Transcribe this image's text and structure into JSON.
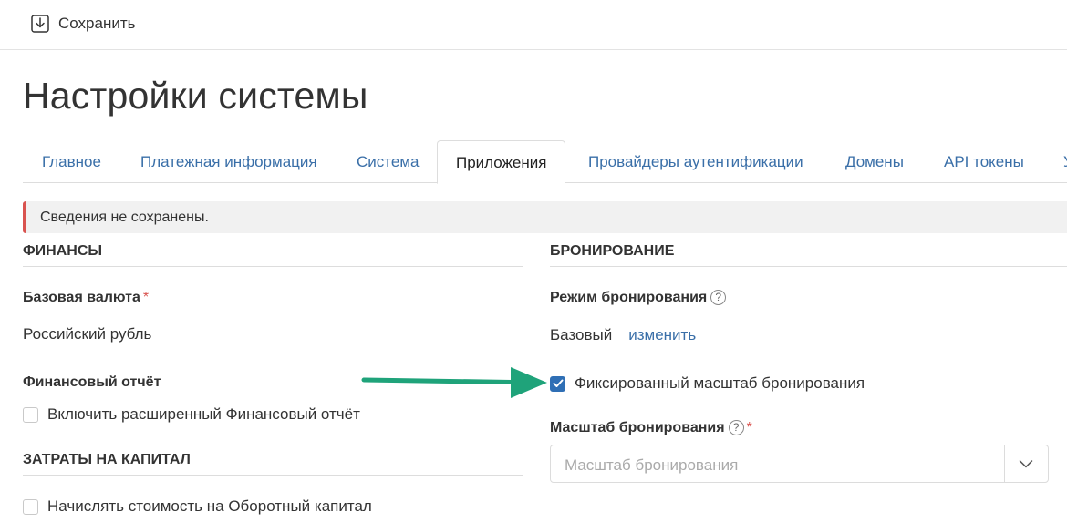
{
  "toolbar": {
    "save_label": "Сохранить",
    "save_icon": "save-download-icon"
  },
  "page": {
    "title": "Настройки системы"
  },
  "tabs": [
    {
      "label": "Главное"
    },
    {
      "label": "Платежная информация"
    },
    {
      "label": "Система"
    },
    {
      "label": "Приложения",
      "active": true
    },
    {
      "label": "Провайдеры аутентификации"
    },
    {
      "label": "Домены"
    },
    {
      "label": "API токены"
    },
    {
      "label": "У"
    }
  ],
  "alert": {
    "text": "Сведения не сохранены.",
    "color": "#d9534f"
  },
  "finance": {
    "title": "Финансы",
    "base_currency": {
      "label": "Базовая валюта",
      "required": "*",
      "value": "Российский рубль"
    },
    "report": {
      "label": "Финансовый отчёт",
      "checkbox_label": "Включить расширенный Финансовый отчёт",
      "checked": false
    }
  },
  "capital": {
    "title": "Затраты на капитал",
    "checkbox_label": "Начислять стоимость на Оборотный капитал",
    "checked": false
  },
  "booking": {
    "title": "Бронирование",
    "mode": {
      "label": "Режим бронирования",
      "help": "?",
      "value": "Базовый",
      "change_link": "изменить"
    },
    "fixed_scale": {
      "label": "Фиксированный масштаб бронирования",
      "checked": true
    },
    "scale": {
      "label": "Масштаб бронирования",
      "help": "?",
      "required": "*",
      "placeholder": "Масштаб бронирования"
    }
  },
  "colors": {
    "accent": "#3a6fa8",
    "checkbox": "#2f6fb5",
    "arrow": "#1fa37a"
  }
}
